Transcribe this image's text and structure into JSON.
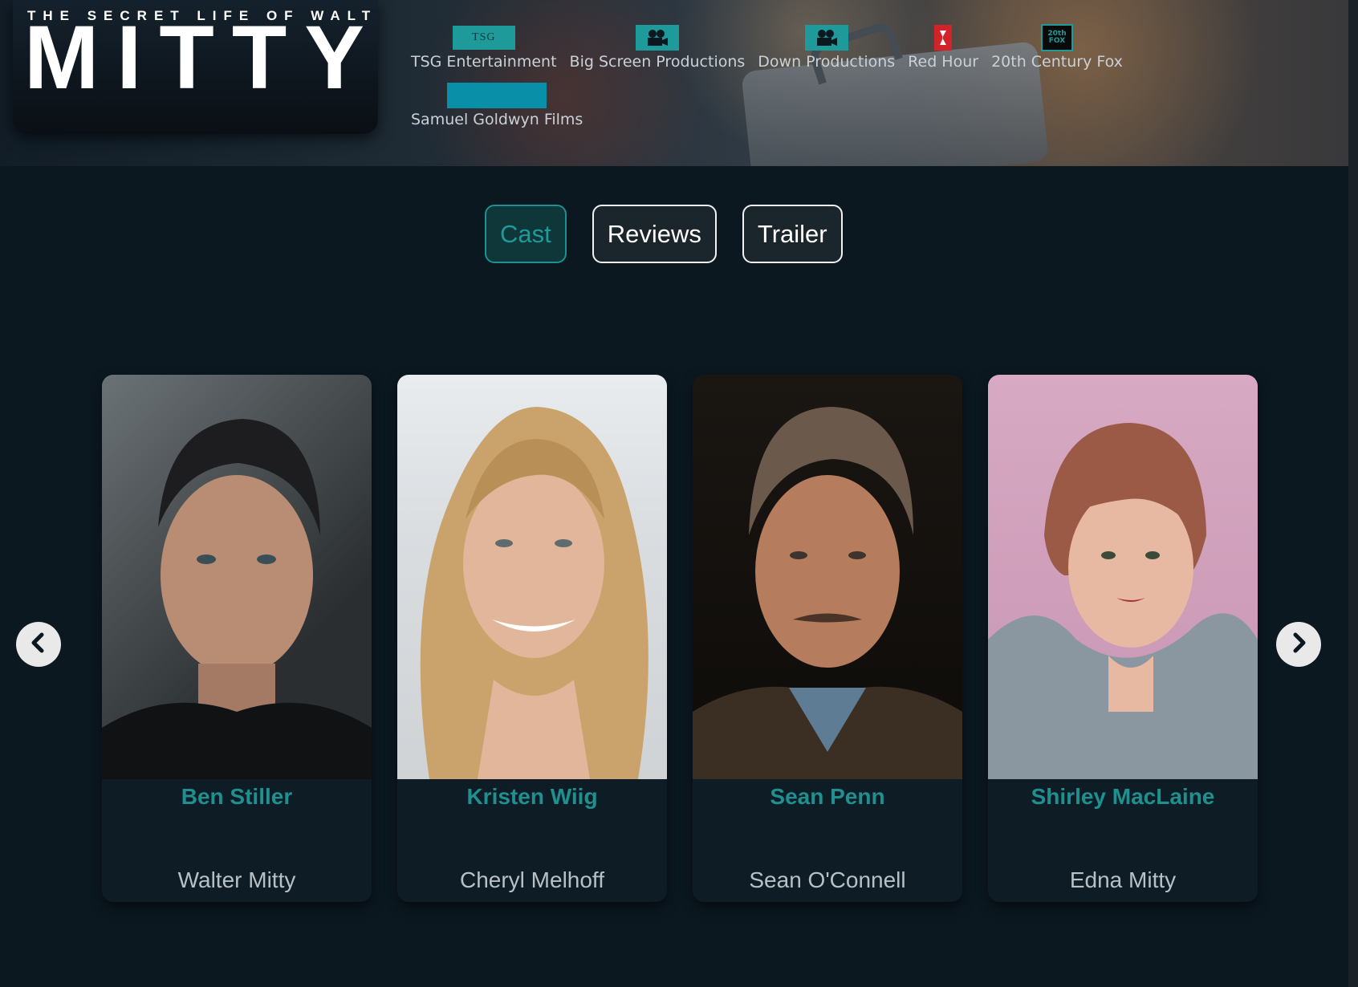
{
  "poster": {
    "subtitle": "THE SECRET LIFE OF WALTER",
    "title": "MITTY"
  },
  "companies": [
    {
      "name": "TSG Entertainment",
      "logo": "tsg-logo",
      "logo_text": "TSG"
    },
    {
      "name": "Big Screen Productions",
      "logo": "film-camera-icon"
    },
    {
      "name": "Down Productions",
      "logo": "film-camera-icon"
    },
    {
      "name": "Red Hour",
      "logo": "red-hour-logo"
    },
    {
      "name": "20th Century Fox",
      "logo": "fox-logo",
      "logo_text": "20th FOX"
    },
    {
      "name": "Samuel Goldwyn Films",
      "logo": "sgf-logo"
    }
  ],
  "tabs": [
    {
      "label": "Cast",
      "active": true
    },
    {
      "label": "Reviews",
      "active": false
    },
    {
      "label": "Trailer",
      "active": false
    }
  ],
  "cast": [
    {
      "actor": "Ben Stiller",
      "character": "Walter Mitty"
    },
    {
      "actor": "Kristen Wiig",
      "character": "Cheryl Melhoff"
    },
    {
      "actor": "Sean Penn",
      "character": "Sean O'Connell"
    },
    {
      "actor": "Shirley MacLaine",
      "character": "Edna Mitty"
    }
  ],
  "colors": {
    "background": "#0b1820",
    "accent": "#1f8f8f",
    "card": "#0e1d25"
  }
}
